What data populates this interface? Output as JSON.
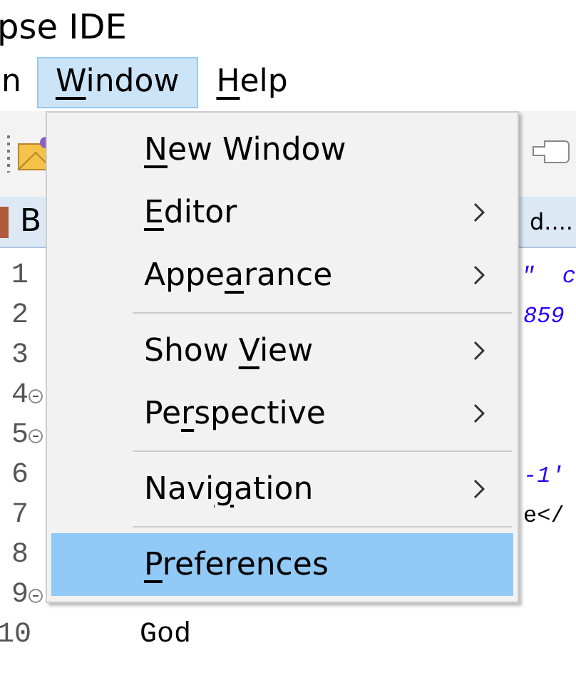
{
  "window": {
    "title": "pse IDE"
  },
  "menubar": [
    {
      "post": "n",
      "selected": false
    },
    {
      "key": "W",
      "post": "indow",
      "selected": true
    },
    {
      "key": "H",
      "post": "elp",
      "selected": false
    }
  ],
  "editor_tabs": [
    {
      "label": "B"
    },
    {
      "label": "d...."
    }
  ],
  "editor": {
    "lines": [
      {
        "number": "1",
        "fold": false,
        "tail": "\"  c",
        "italic": true
      },
      {
        "number": "2",
        "fold": false,
        "tail": "859",
        "italic": true
      },
      {
        "number": "3",
        "fold": false
      },
      {
        "number": "4",
        "fold": true
      },
      {
        "number": "5",
        "fold": true
      },
      {
        "number": "6",
        "fold": false,
        "tail": "-1'",
        "italic": true
      },
      {
        "number": "7",
        "fold": false,
        "tail": "e</",
        "italic": false
      },
      {
        "number": "8",
        "fold": false
      },
      {
        "number": "9",
        "fold": true
      },
      {
        "number": "10",
        "fold": false,
        "text": "God"
      }
    ]
  },
  "menu": {
    "items": [
      {
        "kind": "item",
        "key": "N",
        "post": "ew Window",
        "submenu": false,
        "selected": false
      },
      {
        "kind": "item",
        "key": "E",
        "post": "ditor",
        "submenu": true,
        "selected": false
      },
      {
        "kind": "item",
        "pre": "Appe",
        "key": "a",
        "post": "rance",
        "submenu": true,
        "selected": false
      },
      {
        "kind": "separator"
      },
      {
        "kind": "item",
        "pre": "Show ",
        "key": "V",
        "post": "iew",
        "submenu": true,
        "selected": false
      },
      {
        "kind": "item",
        "pre": "Pe",
        "key": "r",
        "post": "spective",
        "submenu": true,
        "selected": false
      },
      {
        "kind": "separator"
      },
      {
        "kind": "item",
        "pre": "Navi",
        "key": "g",
        "post": "ation",
        "submenu": true,
        "selected": false
      },
      {
        "kind": "separator"
      },
      {
        "kind": "item",
        "key": "P",
        "post": "references",
        "submenu": false,
        "selected": true
      }
    ]
  }
}
